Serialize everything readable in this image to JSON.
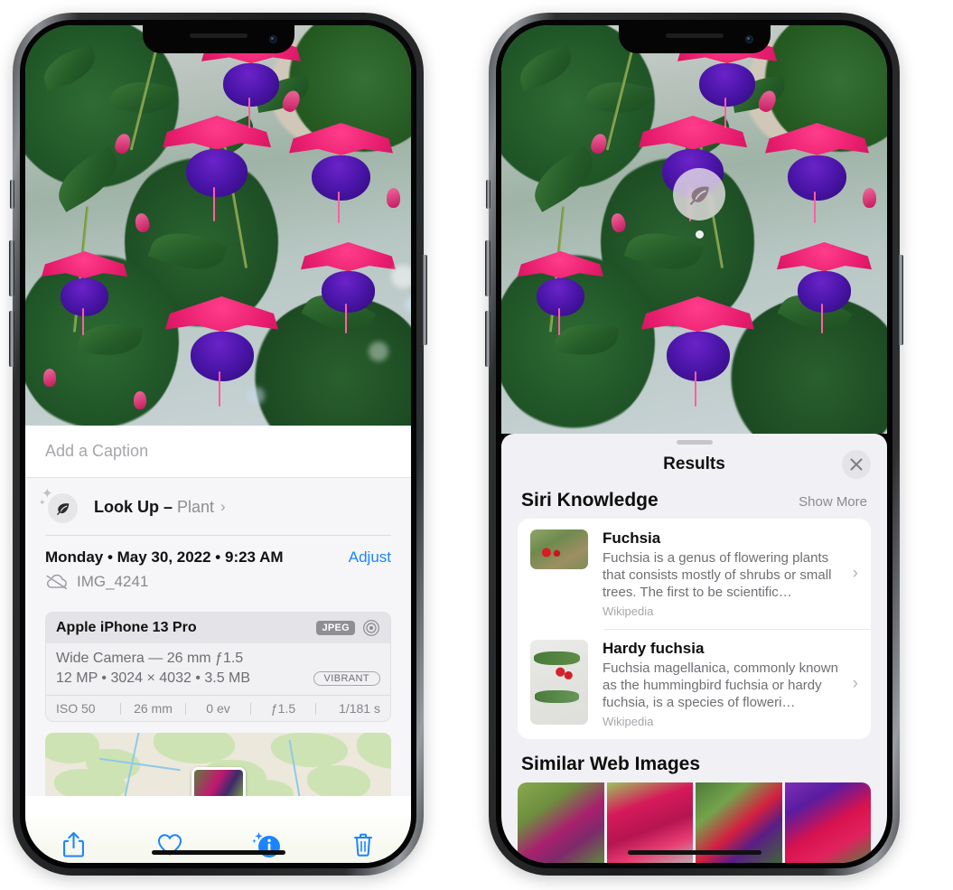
{
  "left_phone": {
    "name": "iPhone showing Photos info panel",
    "caption_field": {
      "placeholder": "Add a Caption",
      "value": ""
    },
    "lookup": {
      "icon": "leaf-icon",
      "label": "Look Up",
      "dash": "–",
      "subject": "Plant",
      "chevron": "›"
    },
    "metadata": {
      "date": "Monday • May 30, 2022 • 9:23 AM",
      "adjust_label": "Adjust",
      "cloud_icon": "cloud-slash-icon",
      "filename": "IMG_4241"
    },
    "camera_card": {
      "device": "Apple iPhone 13 Pro",
      "format_badge": "JPEG",
      "aperture_icon": "aperture-icon",
      "lens_line": "Wide Camera — 26 mm ƒ1.5",
      "size_line": "12 MP • 3024 × 4032 • 3.5 MB",
      "style_badge": "VIBRANT",
      "exif": [
        "ISO 50",
        "26 mm",
        "0 ev",
        "ƒ1.5",
        "1/181 s"
      ]
    },
    "map": {
      "pin_label": "photo-location-pin"
    },
    "toolbar": [
      {
        "name": "share-button",
        "icon": "share-icon"
      },
      {
        "name": "favorite-button",
        "icon": "heart-icon"
      },
      {
        "name": "info-button",
        "icon": "info-sparkle-icon"
      },
      {
        "name": "delete-button",
        "icon": "trash-icon"
      }
    ],
    "accent_color": "#1a84ff"
  },
  "right_phone": {
    "name": "iPhone showing Visual Look Up results",
    "photo_badge": {
      "icon": "leaf-icon",
      "label": "visual-lookup-badge"
    },
    "sheet": {
      "title": "Results",
      "close_icon": "close-icon",
      "sections": [
        {
          "title": "Siri Knowledge",
          "action": "Show More",
          "items": [
            {
              "title": "Fuchsia",
              "description": "Fuchsia is a genus of flowering plants that consists mostly of shrubs or small trees. The first to be scientific…",
              "source": "Wikipedia",
              "chevron": "›"
            },
            {
              "title": "Hardy fuchsia",
              "description": "Fuchsia magellanica, commonly known as the hummingbird fuchsia or hardy fuchsia, is a species of floweri…",
              "source": "Wikipedia",
              "chevron": "›"
            }
          ]
        },
        {
          "title": "Similar Web Images",
          "action": "",
          "images": [
            "web-image-1",
            "web-image-2",
            "web-image-3",
            "web-image-4"
          ]
        }
      ]
    }
  }
}
